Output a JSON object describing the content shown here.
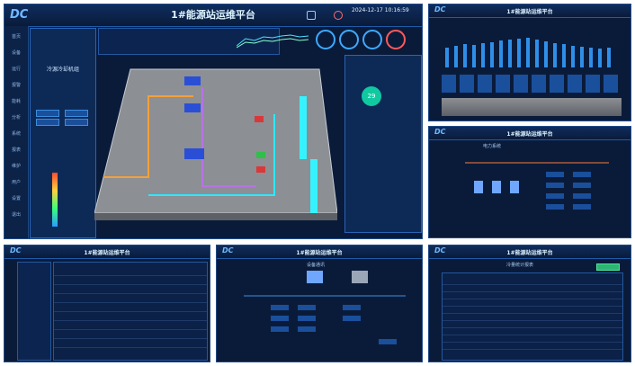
{
  "main": {
    "title": "1#能源站运维平台",
    "datetime": "2024-12-17 10:16:59",
    "logo": "DC",
    "side_labels": [
      "首页",
      "设备",
      "运行",
      "报警",
      "能耗",
      "分析",
      "系统",
      "报表",
      "维护",
      "用户",
      "设置",
      "退出"
    ],
    "system_panel_title": "冷源冷却机组",
    "right_badge_value": "29",
    "gauge_colors": [
      "#3fa9ff",
      "#3fa9ff",
      "#3fa9ff",
      "#ff5a5a"
    ],
    "accent": "#00d5ff"
  },
  "p2": {
    "logo": "DC",
    "title": "1#能源站运维平台"
  },
  "p3": {
    "logo": "DC",
    "title": "1#能源站运维平台",
    "subtitle": "电力系统"
  },
  "p4": {
    "logo": "DC",
    "title": "1#能源站运维平台"
  },
  "p5": {
    "logo": "DC",
    "title": "1#能源站运维平台",
    "subtitle": "设备通讯"
  },
  "p6": {
    "logo": "DC",
    "title": "1#能源站运维平台",
    "subtitle": "冷量统计报表"
  }
}
